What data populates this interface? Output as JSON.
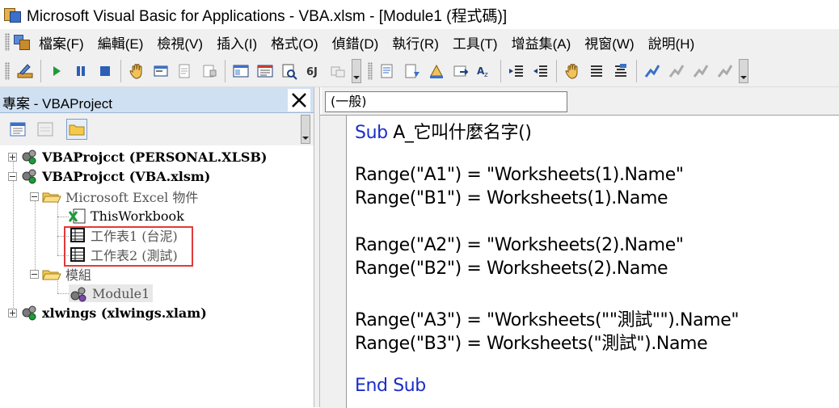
{
  "window": {
    "title": "Microsoft Visual Basic for Applications - VBA.xlsm - [Module1 (程式碼)]"
  },
  "menu": {
    "items": [
      {
        "label": "檔案(F)"
      },
      {
        "label": "編輯(E)"
      },
      {
        "label": "檢視(V)"
      },
      {
        "label": "插入(I)"
      },
      {
        "label": "格式(O)"
      },
      {
        "label": "偵錯(D)"
      },
      {
        "label": "執行(R)"
      },
      {
        "label": "工具(T)"
      },
      {
        "label": "增益集(A)"
      },
      {
        "label": "視窗(W)"
      },
      {
        "label": "說明(H)"
      }
    ]
  },
  "toolbar": {
    "icons": [
      "design-mode-icon",
      "run-icon",
      "pause-icon",
      "stop-icon",
      "hand-icon",
      "user-form-icon",
      "module-icon",
      "class-module-icon",
      "procedure-icon",
      "project-explorer-icon",
      "properties-window-icon",
      "object-browser-icon",
      "toolbox-icon",
      "list-properties-icon",
      "list-constants-icon",
      "quick-info-icon",
      "parameter-info-icon",
      "complete-word-icon",
      "indent-icon",
      "outdent-icon",
      "toggle-breakpoint-icon",
      "comment-block-icon",
      "uncomment-block-icon",
      "toggle-bookmark-icon",
      "next-bookmark-icon",
      "previous-bookmark-icon",
      "clear-bookmarks-icon"
    ]
  },
  "project": {
    "title": "專案 - VBAProject",
    "tree": {
      "personal": "VBAProjcct (PERSONAL.XLSB)",
      "vba": "VBAProjcct (VBA.xlsm)",
      "excel_objects": "Microsoft Excel 物件",
      "this_workbook": "ThisWorkbook",
      "sheet1": "工作表1 (台泥)",
      "sheet2": "工作表2 (測試)",
      "modules": "模組",
      "module1": "Module1",
      "xlwings": "xlwings (xlwings.xlam)"
    }
  },
  "code": {
    "object_combo": "(一般)",
    "lines": {
      "l1_kw": "Sub",
      "l1_rest": " A_它叫什麼名字()",
      "l2": "Range(\"A1\") = \"Worksheets(1).Name\"",
      "l3": "Range(\"B1\") = Worksheets(1).Name",
      "l4": "Range(\"A2\") = \"Worksheets(2).Name\"",
      "l5": "Range(\"B2\") = Worksheets(2).Name",
      "l6": "Range(\"A3\") = \"Worksheets(\"\"測試\"\").Name\"",
      "l7": "Range(\"B3\") = Worksheets(\"測試\").Name",
      "l8": "End Sub"
    }
  },
  "colors": {
    "keyword": "#1a2ec8",
    "highlight_box": "#e03a3a",
    "project_header": "#cfe0f2"
  }
}
